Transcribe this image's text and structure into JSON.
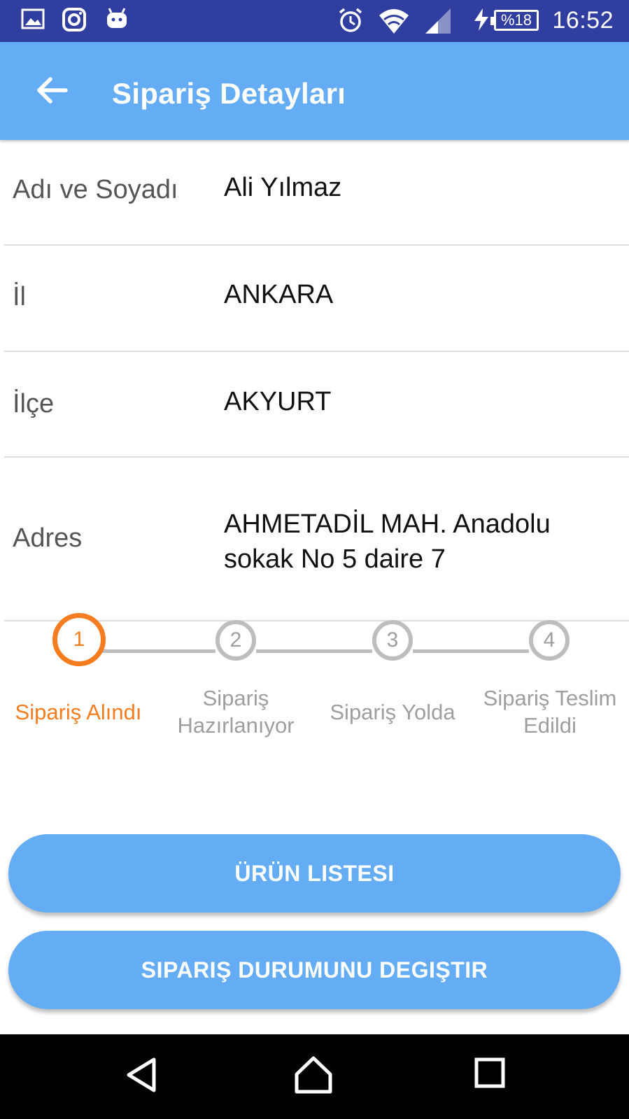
{
  "status_bar": {
    "time": "16:52",
    "battery_level": "%18",
    "left_icons": [
      "gallery-icon",
      "instagram-icon",
      "android-icon"
    ],
    "right_icons": [
      "alarm-icon",
      "wifi-icon",
      "signal-icon",
      "charging-icon",
      "battery-icon"
    ]
  },
  "app_bar": {
    "title": "Sipariş Detayları",
    "back_icon": "arrow-left-icon"
  },
  "details": [
    {
      "label": "Adı ve Soyadı",
      "value": "Ali Yılmaz"
    },
    {
      "label": "İl",
      "value": "ANKARA"
    },
    {
      "label": "İlçe",
      "value": "AKYURT"
    },
    {
      "label": "Adres",
      "value": "AHMETADİL MAH. Anadolu sokak No 5 daire 7"
    }
  ],
  "stepper": {
    "steps": [
      {
        "number": "1",
        "label": "Sipariş Alındı",
        "state": "active"
      },
      {
        "number": "2",
        "label": "Sipariş Hazırlanıyor",
        "state": "pending"
      },
      {
        "number": "3",
        "label": "Sipariş Yolda",
        "state": "pending"
      },
      {
        "number": "4",
        "label": "Sipariş Teslim Edildi",
        "state": "pending"
      }
    ],
    "active_color": "#f57c1f",
    "inactive_color": "#bdbdbd"
  },
  "buttons": {
    "product_list": "ÜRÜN LISTESI",
    "change_status": "SIPARIŞ DURUMUNU DEGIŞTIR"
  },
  "nav_bar": {
    "icons": [
      "back-triangle-icon",
      "home-icon",
      "recents-icon"
    ]
  },
  "colors": {
    "status_bar": "#303f9f",
    "app_bar": "#64adf5",
    "button": "#64adf5",
    "accent": "#f57c1f"
  }
}
